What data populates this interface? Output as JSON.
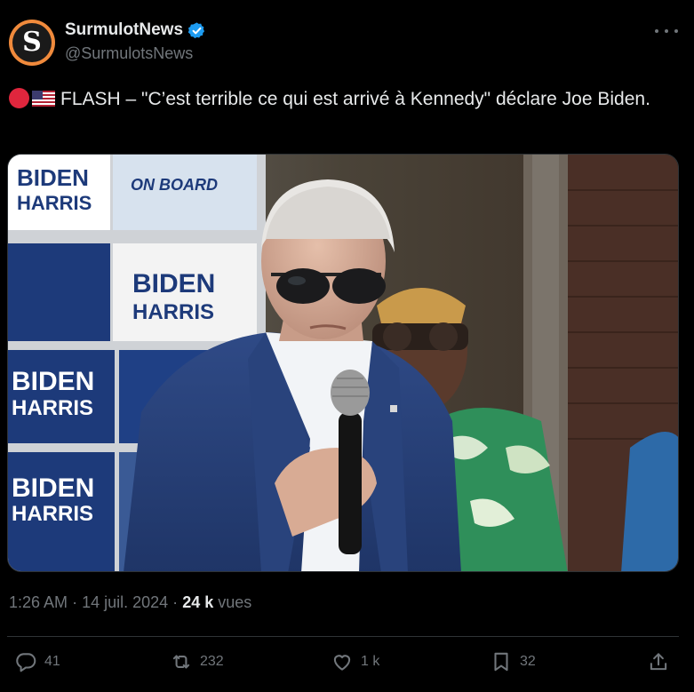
{
  "author": {
    "display_name": "SurmulotNews",
    "handle": "@SurmulotsNews",
    "avatar_letter": "S",
    "verified": true
  },
  "tweet": {
    "emojis": [
      "red-circle",
      "us-flag"
    ],
    "text": "FLASH – \"C’est terrible ce qui est arrivé à Kennedy\" déclare Joe Biden."
  },
  "media": {
    "sign_text_1": "BIDEN",
    "sign_text_2": "HARRIS",
    "sign_text_3": "ON BOARD"
  },
  "meta": {
    "time": "1:26 AM",
    "separator": "·",
    "date": "14 juil. 2024",
    "views_count": "24 k",
    "views_label": "vues"
  },
  "actions": {
    "replies": "41",
    "reposts": "232",
    "likes": "1 k",
    "bookmarks": "32"
  },
  "colors": {
    "background": "#000000",
    "text": "#e7e9ea",
    "muted": "#71767b",
    "verified": "#1d9bf0",
    "avatar_ring": "#f08a3c"
  }
}
